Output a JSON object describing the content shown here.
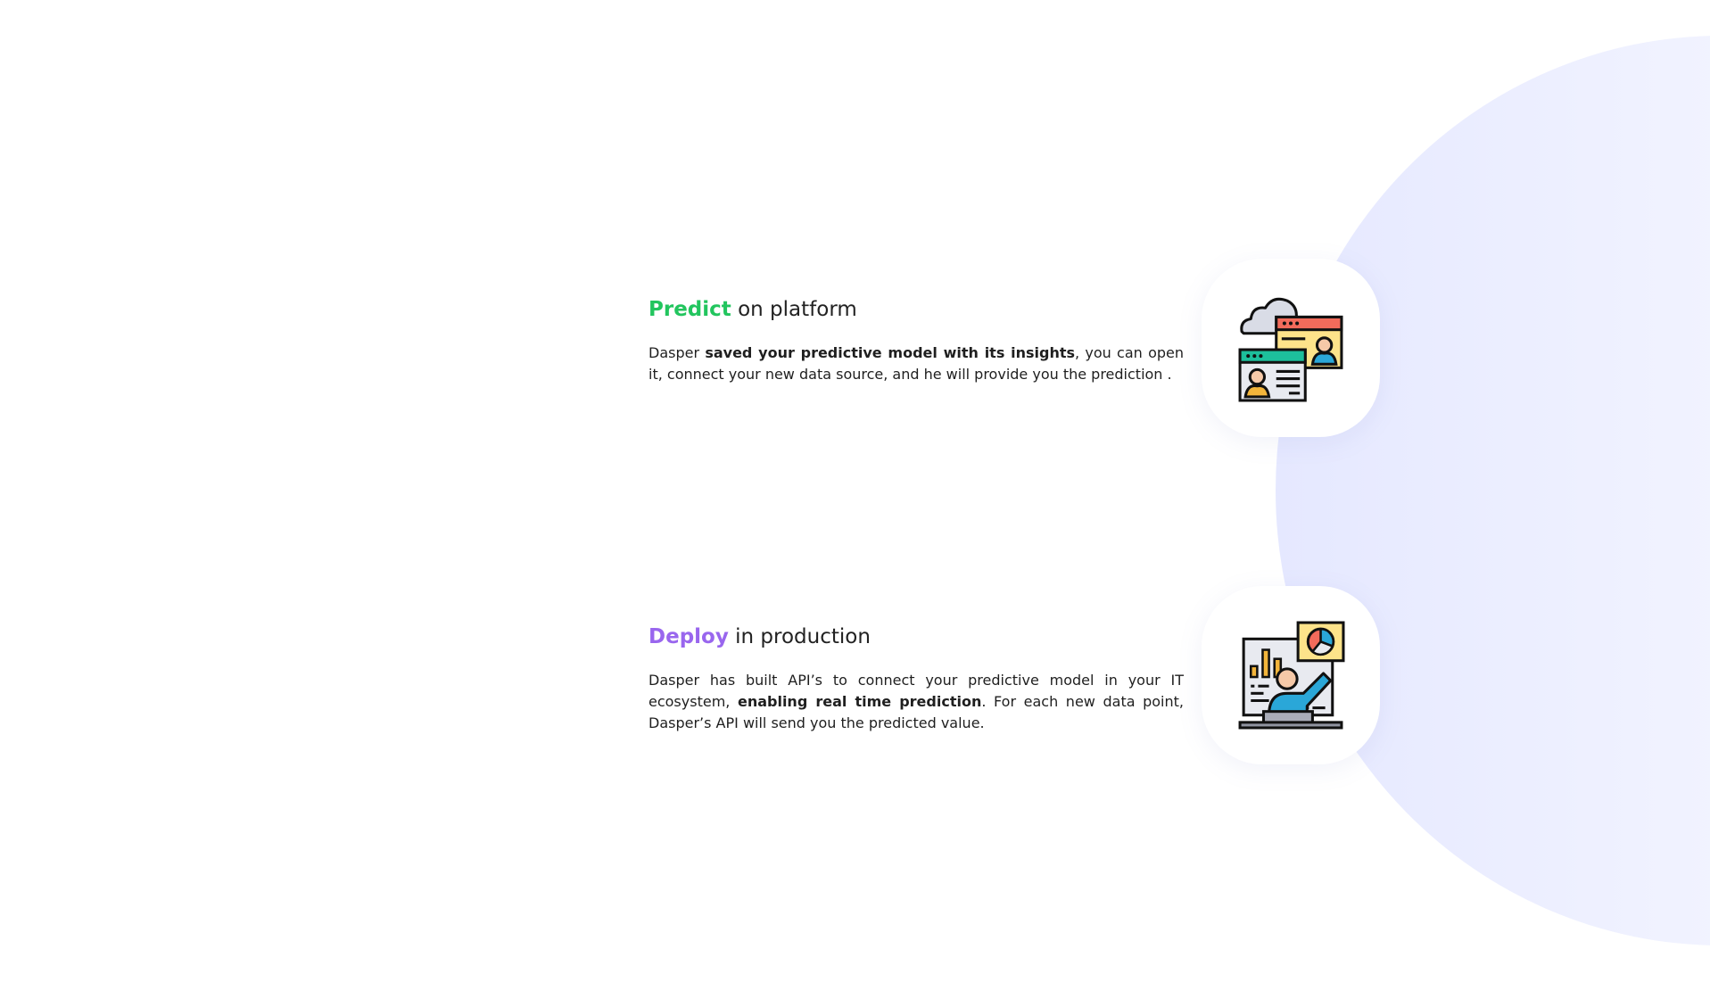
{
  "colors": {
    "predict_accent": "#22c55e",
    "deploy_accent": "#9966ee",
    "background_blob": "#eceeff"
  },
  "features": [
    {
      "title_accent": "Predict",
      "title_rest": " on platform",
      "desc_part1": "Dasper ",
      "desc_bold": "saved your predictive model with its insights",
      "desc_part2": ", you can open it, connect your new data source, and he will provide you the prediction .",
      "icon": "cloud-profiles-icon"
    },
    {
      "title_accent": "Deploy",
      "title_rest": " in production",
      "desc_part1": "Dasper has built API’s to connect your predictive model in your IT ecosystem, ",
      "desc_bold": "enabling real time prediction",
      "desc_part2": ". For each new data point, Dasper’s API will send you the predicted value.",
      "icon": "presentation-dashboard-icon"
    }
  ]
}
